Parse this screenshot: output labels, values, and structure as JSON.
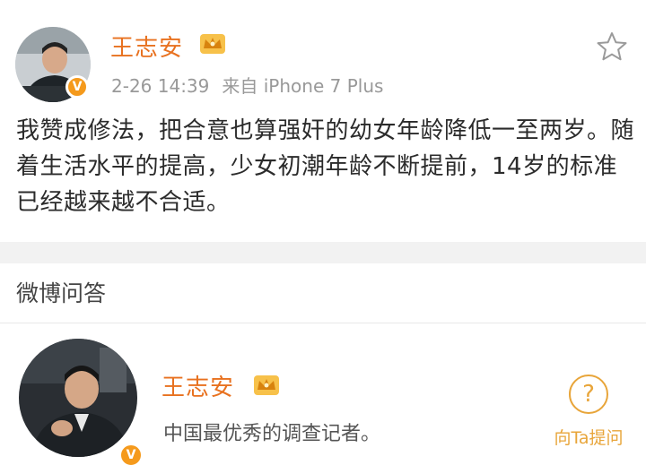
{
  "post": {
    "author": "王志安",
    "date": "2-26 14:39",
    "source": "来自 iPhone 7 Plus",
    "verified_badge": "V",
    "text": "我赞成修法，把合意也算强奸的幼女年龄降低一至两岁。随着生活水平的提高，少女初潮年龄不断提前，14岁的标准已经越来越不合适。"
  },
  "qa": {
    "title": "微博问答",
    "author": "王志安",
    "verified_badge": "V",
    "description": "中国最优秀的调查记者。",
    "ask_label": "向Ta提问",
    "ask_icon_glyph": "?"
  },
  "icons": {
    "star": "star-icon",
    "crown": "crown-icon",
    "question": "question-icon"
  },
  "colors": {
    "name": "#e8711f",
    "badge": "#f59a1c",
    "ask": "#e8a53a",
    "divider": "#f2f2f2"
  }
}
